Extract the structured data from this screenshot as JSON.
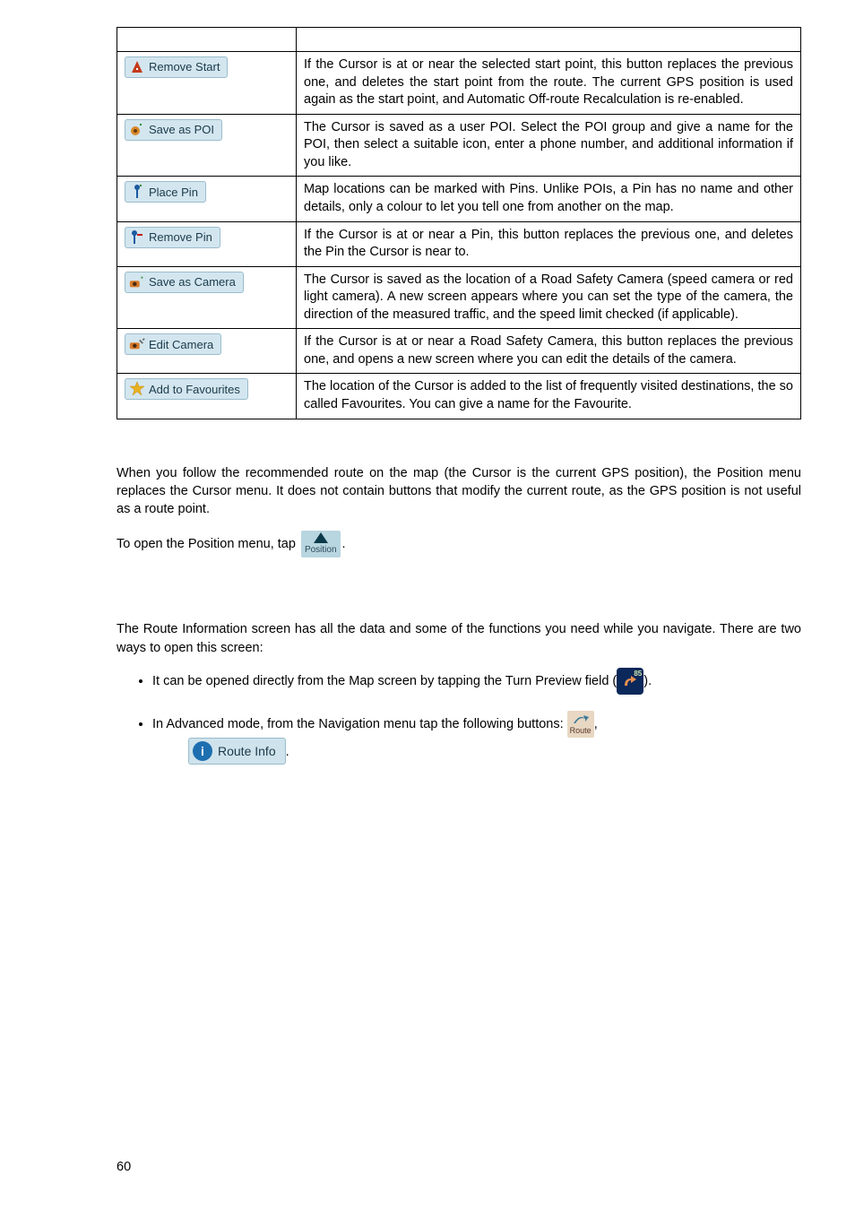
{
  "table": {
    "rows": [
      {
        "button_label": "Remove Start",
        "icon": "remove-start",
        "desc": "If the Cursor is at or near the selected start point, this button replaces the previous one, and deletes the start point from the route. The current GPS position is used again as the start point, and Automatic Off-route Recalculation is re-enabled."
      },
      {
        "button_label": "Save as POI",
        "icon": "save-poi",
        "desc": "The Cursor is saved as a user POI. Select the POI group and give a name for the POI, then select a suitable icon, enter a phone number, and additional information if you like."
      },
      {
        "button_label": "Place Pin",
        "icon": "place-pin",
        "desc": "Map locations can be marked with Pins. Unlike POIs, a Pin has no name and other details, only a colour to let you tell one from another on the map."
      },
      {
        "button_label": "Remove Pin",
        "icon": "remove-pin",
        "desc": "If the Cursor is at or near a Pin, this button replaces the previous one, and deletes the Pin the Cursor is near to."
      },
      {
        "button_label": "Save as Camera",
        "icon": "save-camera",
        "desc": "The Cursor is saved as the location of a Road Safety Camera (speed camera or red light camera). A new screen appears where you can set the type of the camera, the direction of the measured traffic, and the speed limit checked (if applicable)."
      },
      {
        "button_label": "Edit Camera",
        "icon": "edit-camera",
        "desc": "If the Cursor is at or near a Road Safety Camera, this button replaces the previous one, and opens a new screen where you can edit the details of the camera."
      },
      {
        "button_label": "Add to Favourites",
        "icon": "add-fav",
        "desc": "The location of the Cursor is added to the list of frequently visited destinations, the so called Favourites. You can give a name for the Favourite."
      }
    ]
  },
  "position_para": "When you follow the recommended route on the map (the Cursor is the current GPS position), the Position menu replaces the Cursor menu. It does not contain buttons that modify the current route, as the GPS position is not useful as a route point.",
  "position_open_prefix": "To open the Position menu, tap ",
  "position_icon_label": "Position",
  "routeinfo_para": "The Route Information screen has all the data and some of the functions you need while you navigate. There are two ways to open this screen:",
  "bullet1_prefix": "It can be opened directly from the Map screen by tapping the Turn Preview field (",
  "bullet1_suffix": ").",
  "bullet2_prefix": "In Advanced mode, from the Navigation menu tap the following buttons: ",
  "bullet2_suffix": ",",
  "turn_preview_number": "85",
  "route_icon_label": "Route",
  "route_info_label": "Route Info",
  "page_number": "60"
}
